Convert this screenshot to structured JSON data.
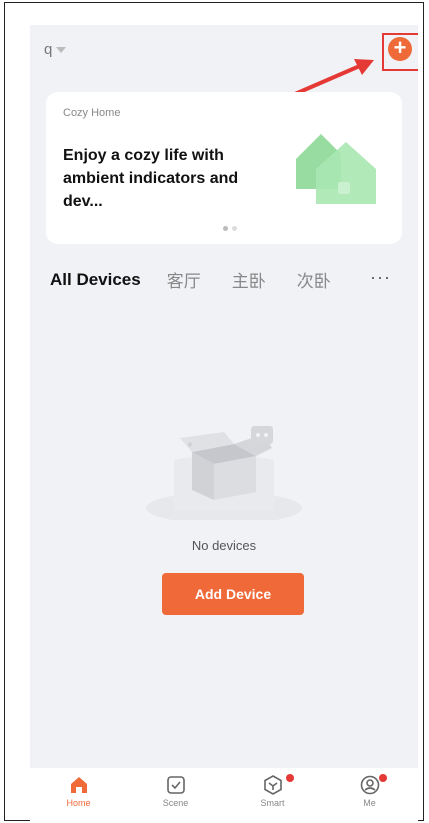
{
  "header": {
    "home_name": "q",
    "add_icon_glyph": "+"
  },
  "banner": {
    "kicker": "Cozy Home",
    "title": "Enjoy a cozy life with ambient indicators and dev...",
    "page_index": 0,
    "page_count": 2
  },
  "room_tabs": {
    "items": [
      "All Devices",
      "客厅",
      "主卧",
      "次卧"
    ],
    "more_label": "···",
    "selected": "All Devices"
  },
  "empty_state": {
    "label": "No devices",
    "button_label": "Add Device"
  },
  "tabbar": {
    "items": [
      {
        "label": "Home",
        "icon": "home-icon",
        "active": true,
        "badge": false
      },
      {
        "label": "Scene",
        "icon": "scene-check-icon",
        "active": false,
        "badge": false
      },
      {
        "label": "Smart",
        "icon": "smart-cube-icon",
        "active": false,
        "badge": true
      },
      {
        "label": "Me",
        "icon": "profile-icon",
        "active": false,
        "badge": true
      }
    ]
  },
  "colors": {
    "accent": "#ef6a38",
    "background": "#f1f2f6",
    "annotation": "#e53935",
    "badge": "#e53935"
  }
}
